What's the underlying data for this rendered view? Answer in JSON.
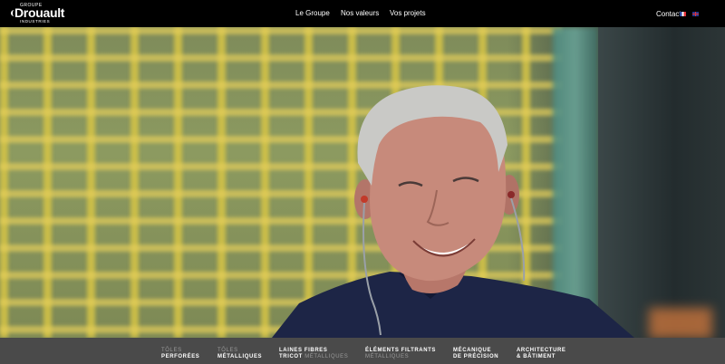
{
  "header": {
    "logo": {
      "groupe": "GROUPE",
      "brand": "Drouault",
      "industries": "INDUSTRIES"
    },
    "nav": [
      "Le Groupe",
      "Nos valeurs",
      "Vos projets"
    ],
    "contact": "Contact",
    "languages": [
      "fr-flag-icon",
      "uk-flag-icon"
    ]
  },
  "hero": {
    "image": "photo of smiling man wearing ear protection in front of yellow metal grid"
  },
  "categories": [
    {
      "line1": "Tôles",
      "line2": "perforées",
      "style1": "muted",
      "style2": "strong"
    },
    {
      "line1": "Tôles",
      "line2": "métalliques",
      "style1": "muted",
      "style2": "strong"
    },
    {
      "line1": "Laines fibres",
      "line2a": "tricot",
      "line2b": " métalliques"
    },
    {
      "line1": "Éléments filtrants",
      "line2": "métalliques"
    },
    {
      "line1": "Mécanique",
      "line2": "de précision"
    },
    {
      "line1": "Architecture",
      "line2": "& bâtiment"
    }
  ],
  "colors": {
    "topbar": "#000000",
    "bottombar": "#4a4a4a",
    "muted_text": "#9a9a9a"
  }
}
